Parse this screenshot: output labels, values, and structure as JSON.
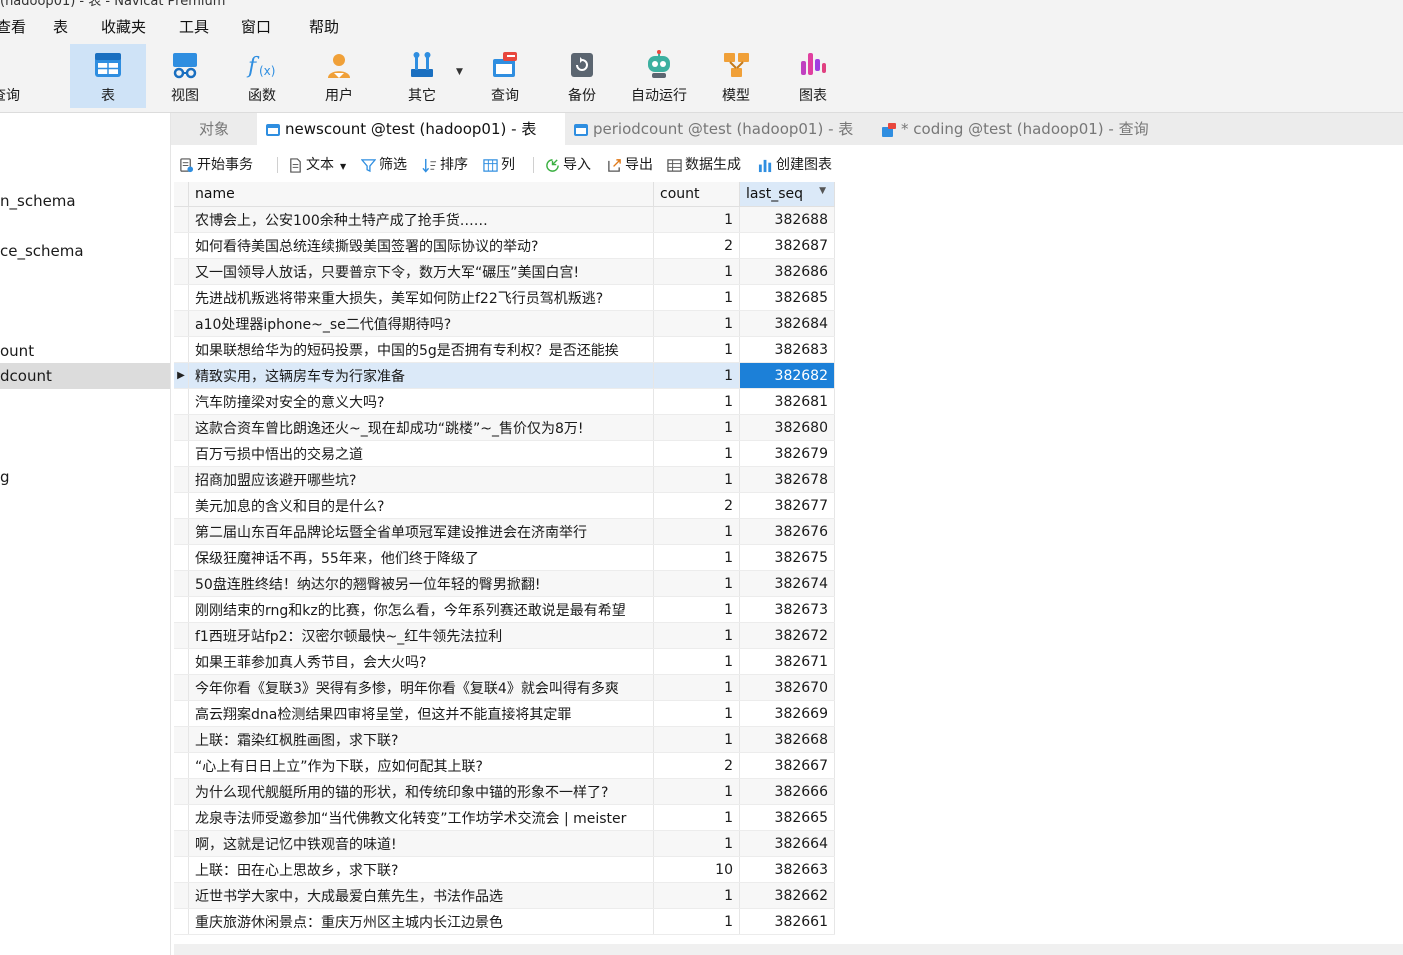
{
  "window": {
    "title_fragment": "(hadoop01) - 表 - Navicat Premium"
  },
  "menu": [
    "查看",
    "表",
    "收藏夹",
    "工具",
    "窗口",
    "帮助"
  ],
  "ribbon": {
    "partial_label": "查询",
    "buttons": [
      {
        "label": "表",
        "icon": "table-icon",
        "active": true
      },
      {
        "label": "视图",
        "icon": "view-icon"
      },
      {
        "label": "函数",
        "icon": "function-icon"
      },
      {
        "label": "用户",
        "icon": "user-icon"
      },
      {
        "label": "其它",
        "icon": "other-tools-icon"
      },
      {
        "label": "查询",
        "icon": "query-icon"
      },
      {
        "label": "备份",
        "icon": "backup-icon"
      },
      {
        "label": "自动运行",
        "icon": "robot-icon"
      },
      {
        "label": "模型",
        "icon": "model-icon"
      },
      {
        "label": "图表",
        "icon": "chart-icon"
      }
    ],
    "colors": {
      "active_bg": "#cfe3f7",
      "accent": "#1c80d8"
    }
  },
  "sidebar": {
    "items": [
      "n_schema",
      "ce_schema",
      "ount",
      "dcount",
      "g"
    ],
    "selected": "dcount"
  },
  "tabs": [
    {
      "label": "对象"
    },
    {
      "label": "newscount @test (hadoop01) - 表",
      "active": true
    },
    {
      "label": "periodcount @test (hadoop01) - 表"
    },
    {
      "label": "* coding @test (hadoop01) - 查询"
    }
  ],
  "toolbar": {
    "begin_tx": "开始事务",
    "text": "文本",
    "filter": "筛选",
    "sort": "排序",
    "columns": "列",
    "import": "导入",
    "export": "导出",
    "generate": "数据生成",
    "create_chart": "创建图表"
  },
  "grid": {
    "columns": [
      "name",
      "count",
      "last_seq"
    ],
    "sorted_column": "last_seq",
    "current_row": 6,
    "rows": [
      [
        "农博会上，公安100余种土特产成了抢手货……",
        "1",
        "382688"
      ],
      [
        "如何看待美国总统连续撕毁美国签署的国际协议的举动?",
        "2",
        "382687"
      ],
      [
        "又一国领导人放话，只要普京下令，数万大军“碾压”美国白宫!",
        "1",
        "382686"
      ],
      [
        "先进战机叛逃将带来重大损失，美军如何防止f22飞行员驾机叛逃?",
        "1",
        "382685"
      ],
      [
        "a10处理器iphone~_se二代值得期待吗?",
        "1",
        "382684"
      ],
      [
        "如果联想给华为的短码投票，中国的5g是否拥有专利权？是否还能挨",
        "1",
        "382683"
      ],
      [
        "精致实用，这辆房车专为行家准备",
        "1",
        "382682"
      ],
      [
        "汽车防撞梁对安全的意义大吗?",
        "1",
        "382681"
      ],
      [
        "这款合资车曾比朗逸还火~_现在却成功“跳楼”~_售价仅为8万!",
        "1",
        "382680"
      ],
      [
        "百万亏损中悟出的交易之道",
        "1",
        "382679"
      ],
      [
        "招商加盟应该避开哪些坑?",
        "1",
        "382678"
      ],
      [
        "美元加息的含义和目的是什么?",
        "2",
        "382677"
      ],
      [
        "第二届山东百年品牌论坛暨全省单项冠军建设推进会在济南举行",
        "1",
        "382676"
      ],
      [
        "保级狂魔神话不再，55年来，他们终于降级了",
        "1",
        "382675"
      ],
      [
        "50盘连胜终结！纳达尔的翘臀被另一位年轻的臀男掀翻!",
        "1",
        "382674"
      ],
      [
        "刚刚结束的rng和kz的比赛，你怎么看，今年系列赛还敢说是最有希望",
        "1",
        "382673"
      ],
      [
        "f1西班牙站fp2：汉密尔顿最快~_红牛领先法拉利",
        "1",
        "382672"
      ],
      [
        "如果王菲参加真人秀节目，会大火吗?",
        "1",
        "382671"
      ],
      [
        "今年你看《复联3》哭得有多惨，明年你看《复联4》就会叫得有多爽",
        "1",
        "382670"
      ],
      [
        "高云翔案dna检测结果四审将呈堂，但这并不能直接将其定罪",
        "1",
        "382669"
      ],
      [
        "上联：霜染红枫胜画图，求下联?",
        "1",
        "382668"
      ],
      [
        "“心上有日日上立”作为下联，应如何配其上联?",
        "2",
        "382667"
      ],
      [
        "为什么现代舰艇所用的锚的形状，和传统印象中锚的形象不一样了?",
        "1",
        "382666"
      ],
      [
        "龙泉寺法师受邀参加“当代佛教文化转变”工作坊学术交流会 | meister",
        "1",
        "382665"
      ],
      [
        "啊，这就是记忆中铁观音的味道!",
        "1",
        "382664"
      ],
      [
        "上联：田在心上思故乡，求下联?",
        "10",
        "382663"
      ],
      [
        "近世书学大家中，大成最爱白蕉先生，书法作品选",
        "1",
        "382662"
      ],
      [
        "重庆旅游休闲景点：重庆万州区主城内长江边景色",
        "1",
        "382661"
      ]
    ]
  }
}
